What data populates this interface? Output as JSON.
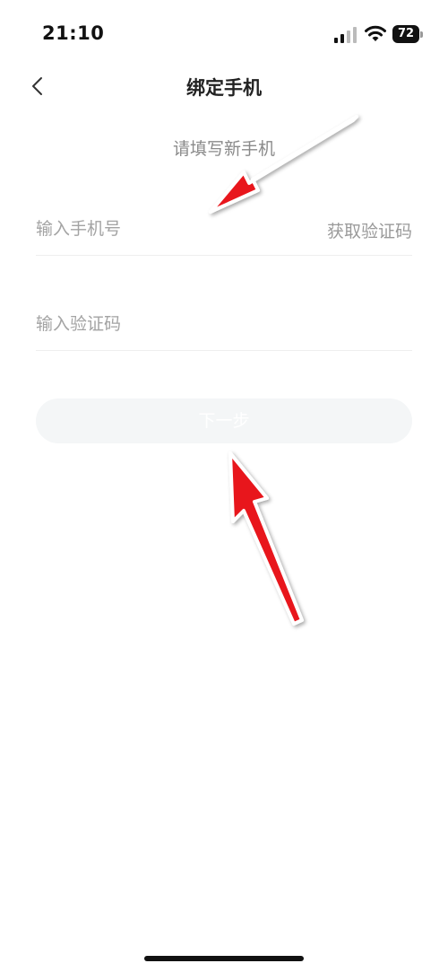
{
  "status_bar": {
    "time": "21:10",
    "battery_level": "72"
  },
  "nav": {
    "title": "绑定手机"
  },
  "form": {
    "subtitle": "请填写新手机",
    "phone_placeholder": "输入手机号",
    "get_code_label": "获取验证码",
    "code_placeholder": "输入验证码",
    "next_label": "下一步"
  },
  "colors": {
    "annotation_arrow": "#e8141c",
    "button_disabled_bg": "#f4f6f7",
    "placeholder_text": "#a3a3a3"
  }
}
